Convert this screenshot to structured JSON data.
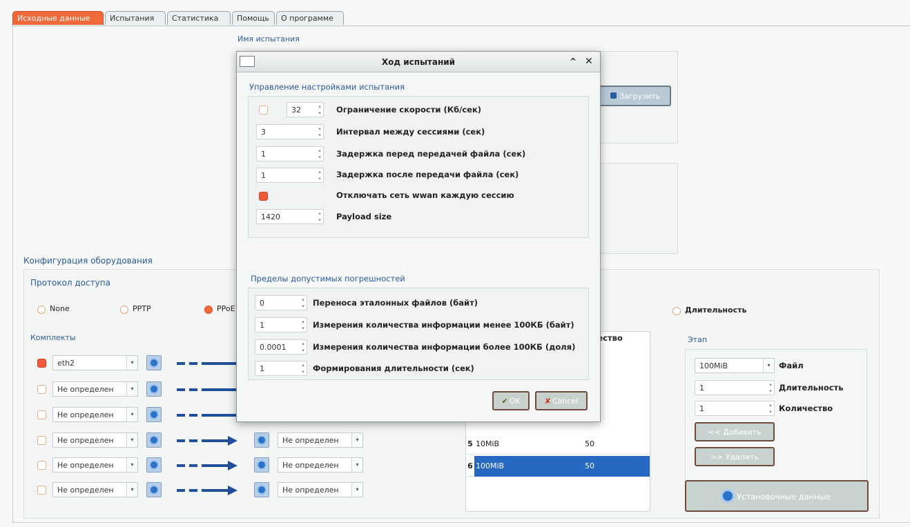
{
  "tabs": [
    "Исходные данные",
    "Испытания",
    "Статистика",
    "Помощь",
    "О программе"
  ],
  "test_name_label": "Имя испытания",
  "load_button": "Загрузить",
  "hw_config_label": "Конфигурация оборудования",
  "protocol": {
    "label": "Протокол доступа",
    "options": [
      "None",
      "PPTP",
      "PPoE"
    ],
    "selected": "PPoE"
  },
  "kits": {
    "label": "Комплекты",
    "rows": [
      {
        "checked": true,
        "left": "eth2",
        "right": ""
      },
      {
        "checked": false,
        "left": "Не определен",
        "right": ""
      },
      {
        "checked": false,
        "left": "Не определен",
        "right": ""
      },
      {
        "checked": false,
        "left": "Не определен",
        "right": "Не определен"
      },
      {
        "checked": false,
        "left": "Не определен",
        "right": "Не определен"
      },
      {
        "checked": false,
        "left": "Не определен",
        "right": "Не определен"
      }
    ]
  },
  "mode_duration_label": "Длительность",
  "table": {
    "header_count": "личество",
    "rows": [
      {
        "n": "5",
        "file": "10MiB",
        "count": "50",
        "selected": false
      },
      {
        "n": "6",
        "file": "100MiB",
        "count": "50",
        "selected": true
      }
    ]
  },
  "stage": {
    "label": "Этап",
    "file_value": "100MiB",
    "file_label": "Файл",
    "duration_value": "1",
    "duration_label": "Длительность",
    "count_value": "1",
    "count_label": "Количество",
    "add_button": "<< Добавить",
    "delete_button": ">> Удалить",
    "setup_button": "Установочные данные"
  },
  "dialog": {
    "title": "Ход испытаний",
    "settings_group": "Управление настройками испытания",
    "speed_value": "32",
    "speed_label": "Ограничение скорости (Кб/сек)",
    "interval_value": "3",
    "interval_label": "Интервал между сессиями (сек)",
    "delay_before_value": "1",
    "delay_before_label": "Задержка перед передачей файла (сек)",
    "delay_after_value": "1",
    "delay_after_label": "Задержка после передачи файла (сек)",
    "wwan_label": "Отключать сеть wwan каждую сессию",
    "payload_value": "1420",
    "payload_label": "Payload size",
    "limits_group": "Пределы допустимых погрешностей",
    "transfer_value": "0",
    "transfer_label": "Переноса эталонных файлов (байт)",
    "measure_small_value": "1",
    "measure_small_label": "Измерения количества информации менее 100КБ (байт)",
    "measure_large_value": "0.0001",
    "measure_large_label": "Измерения количества информации более 100КБ (доля)",
    "duration_value": "1",
    "duration_label": "Формирования длительности (сек)",
    "ok": "OK",
    "cancel": "Cancel"
  },
  "colors": {
    "accent": "#f06a3c",
    "selection": "#2768c2",
    "arrow": "#1f4e9b"
  }
}
